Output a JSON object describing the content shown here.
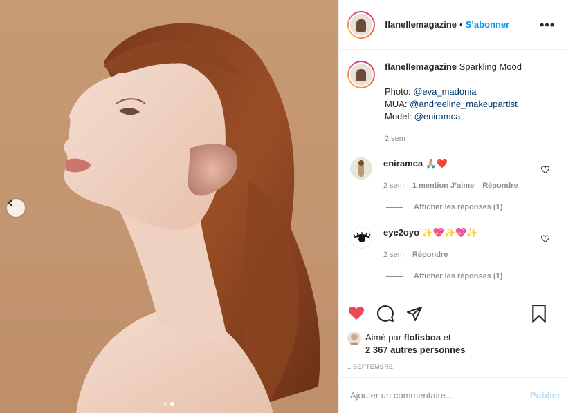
{
  "post": {
    "photo_alt": "Portrait photo",
    "carousel": {
      "dot_count": 2,
      "active_index": 1
    }
  },
  "header": {
    "username": "flanellemagazine",
    "separator": "•",
    "follow_label": "S’abonner",
    "more_label": "•••"
  },
  "caption": {
    "username": "flanellemagazine",
    "text": "Sparkling Mood",
    "photo_prefix": "Photo: ",
    "photo_mention": "@eva_madonia",
    "mua_prefix": "MUA: ",
    "mua_mention": "@andreeline_makeupartist",
    "model_prefix": "Model: ",
    "model_mention": "@eniramca",
    "time": "2 sem"
  },
  "comments": [
    {
      "username": "eniramca",
      "text": "🙏🏼❤️",
      "time": "2 sem",
      "likes": "1 mention J’aime",
      "reply_label": "Répondre",
      "view_replies": "Afficher les réponses (1)"
    },
    {
      "username": "eye2oyo",
      "text": "✨💖✨💖✨",
      "time": "2 sem",
      "reply_label": "Répondre",
      "view_replies": "Afficher les réponses (1)"
    }
  ],
  "likes": {
    "prefix": "Aimé par ",
    "user": "flolisboa",
    "middle": " et",
    "others": "2 367 autres personnes"
  },
  "date": "1 SEPTEMBRE",
  "add_comment": {
    "placeholder": "Ajouter un commentaire...",
    "publish_label": "Publier"
  },
  "colors": {
    "like_red": "#ed4956",
    "link_blue": "#0095f6",
    "mention": "#00376b",
    "muted": "#8e8e8e"
  }
}
